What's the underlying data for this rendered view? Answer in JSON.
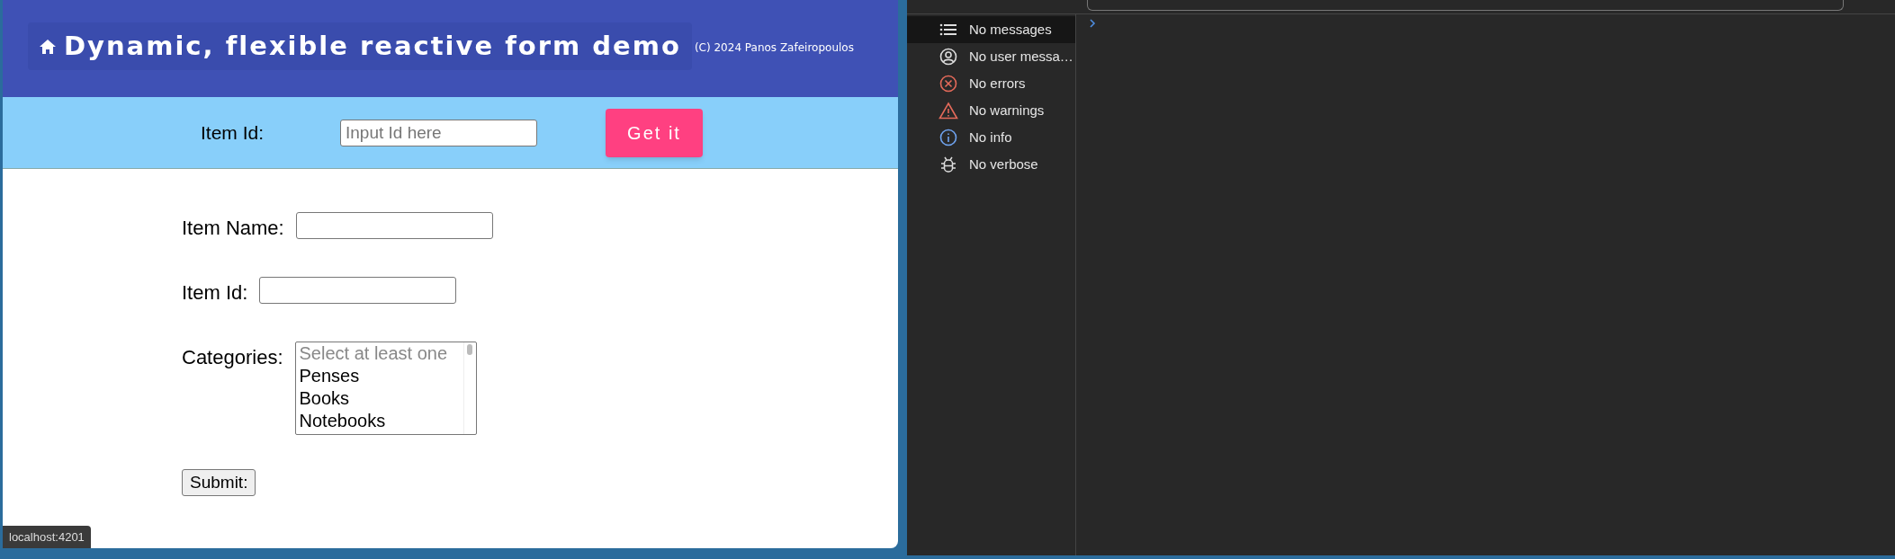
{
  "app": {
    "title": "Dynamic, flexible reactive form demo",
    "copyright": "(C) 2024 Panos Zafeiropoulos"
  },
  "lookup": {
    "label": "Item Id:",
    "placeholder": "Input Id here",
    "button": "Get it"
  },
  "form": {
    "fields": [
      {
        "kind": "text",
        "label": "Item Name:"
      },
      {
        "kind": "text",
        "label": "Item Id:"
      },
      {
        "kind": "select",
        "label": "Categories:",
        "options": [
          {
            "text": "Select at least one",
            "placeholder": true
          },
          {
            "text": "Penses",
            "placeholder": false
          },
          {
            "text": "Books",
            "placeholder": false
          },
          {
            "text": "Notebooks",
            "placeholder": false
          }
        ]
      }
    ],
    "submit": "Submit:"
  },
  "status_bar": {
    "url": "localhost:4201"
  },
  "devtools": {
    "sidebar": {
      "items": [
        {
          "kind": "list",
          "label": "No messages",
          "selected": true
        },
        {
          "kind": "user",
          "label": "No user messa…",
          "selected": false
        },
        {
          "kind": "error",
          "label": "No errors",
          "selected": false
        },
        {
          "kind": "warning",
          "label": "No warnings",
          "selected": false
        },
        {
          "kind": "info",
          "label": "No info",
          "selected": false
        },
        {
          "kind": "verbose",
          "label": "No verbose",
          "selected": false
        }
      ]
    }
  }
}
